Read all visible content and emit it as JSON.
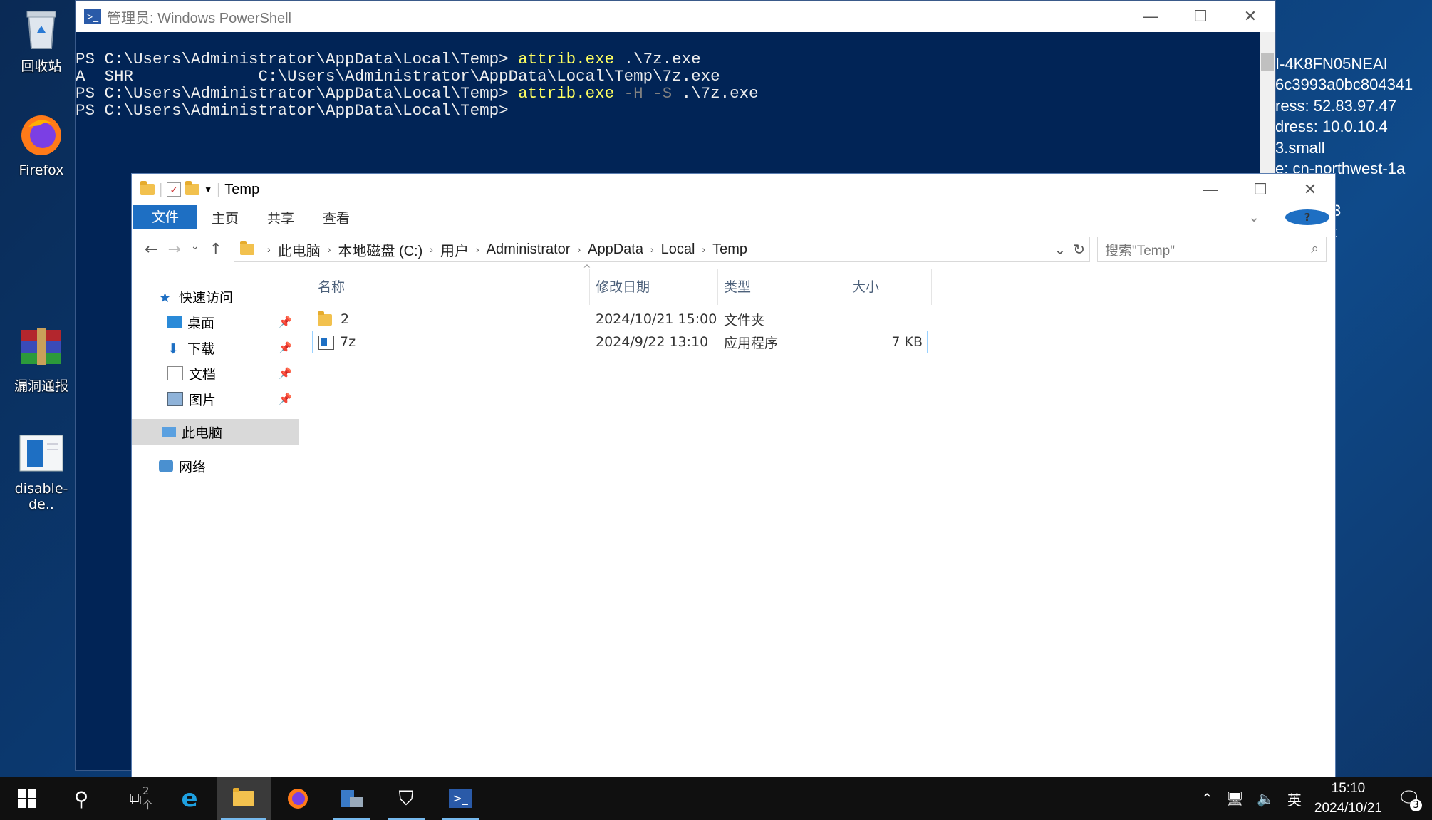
{
  "desktop": {
    "icons": [
      {
        "label": "回收站",
        "icon": "recycle-bin-icon"
      },
      {
        "label": "Firefox",
        "icon": "firefox-icon"
      },
      {
        "label": "漏洞通报",
        "icon": "winrar-icon"
      },
      {
        "label": "disable-de..",
        "icon": "document-icon"
      }
    ],
    "bginfo_lines": [
      "I-4K8FN05NEAI",
      "6c3993a0bc804341",
      "ress: 52.83.97.47",
      "dress: 10.0.10.4",
      "3.small",
      "e: cn-northwest-1a",
      "MD64",
      "3",
      "t"
    ]
  },
  "powershell": {
    "title": "管理员: Windows PowerShell",
    "lines": [
      {
        "prompt": "PS C:\\Users\\Administrator\\AppData\\Local\\Temp> ",
        "cmd": "attrib.exe",
        "params": "",
        "rest": " .\\7z.exe"
      },
      {
        "prompt": "A  SHR             C:\\Users\\Administrator\\AppData\\Local\\Temp\\7z.exe",
        "cmd": "",
        "params": "",
        "rest": ""
      },
      {
        "prompt": "PS C:\\Users\\Administrator\\AppData\\Local\\Temp> ",
        "cmd": "attrib.exe",
        "params": " -H -S",
        "rest": " .\\7z.exe"
      },
      {
        "prompt": "PS C:\\Users\\Administrator\\AppData\\Local\\Temp>",
        "cmd": "",
        "params": "",
        "rest": ""
      }
    ]
  },
  "explorer": {
    "title": "Temp",
    "ribbon_tabs": [
      "文件",
      "主页",
      "共享",
      "查看"
    ],
    "breadcrumb": [
      "此电脑",
      "本地磁盘 (C:)",
      "用户",
      "Administrator",
      "AppData",
      "Local",
      "Temp"
    ],
    "search_placeholder": "搜索\"Temp\"",
    "sidebar": {
      "quick_access": "快速访问",
      "pinned": [
        "桌面",
        "下载",
        "文档",
        "图片"
      ],
      "this_pc": "此电脑",
      "network": "网络"
    },
    "columns": [
      "名称",
      "修改日期",
      "类型",
      "大小"
    ],
    "files": [
      {
        "name": "2",
        "date": "2024/10/21 15:00",
        "type": "文件夹",
        "size": ""
      },
      {
        "name": "7z",
        "date": "2024/9/22 13:10",
        "type": "应用程序",
        "size": "7 KB"
      }
    ],
    "status": "2 个"
  },
  "taskbar": {
    "time": "15:10",
    "date": "2024/10/21",
    "ime": "英",
    "notifications": "3"
  },
  "colors": {
    "powershell_bg": "#012456",
    "accent": "#1e6fc3",
    "taskbar": "#101010"
  }
}
